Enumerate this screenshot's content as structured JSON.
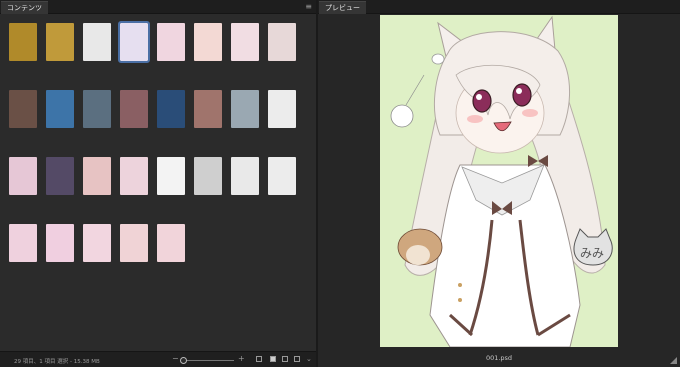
{
  "panels": {
    "contents_tab": "コンテンツ",
    "preview_tab": "プレビュー"
  },
  "thumbs": [
    {
      "color": "#b08a2a",
      "caption": "",
      "selected": false
    },
    {
      "color": "#c09a3a",
      "caption": "",
      "selected": false
    },
    {
      "color": "#e8e8e8",
      "caption": "",
      "selected": false
    },
    {
      "color": "#e6dff0",
      "caption": "",
      "selected": true
    },
    {
      "color": "#f0d6e0",
      "caption": "",
      "selected": false
    },
    {
      "color": "#f3d9d4",
      "caption": "",
      "selected": false
    },
    {
      "color": "#f1dde3",
      "caption": "",
      "selected": false
    },
    {
      "color": "#e7d8d8",
      "caption": "",
      "selected": false
    },
    {
      "color": "#6a5046",
      "caption": "",
      "selected": false
    },
    {
      "color": "#3d74a8",
      "caption": "",
      "selected": false
    },
    {
      "color": "#5b6f80",
      "caption": "",
      "selected": false
    },
    {
      "color": "#8a5f63",
      "caption": "",
      "selected": false
    },
    {
      "color": "#2a4d78",
      "caption": "",
      "selected": false
    },
    {
      "color": "#a0746c",
      "caption": "",
      "selected": false
    },
    {
      "color": "#9aa8b2",
      "caption": "",
      "selected": false
    },
    {
      "color": "#ececec",
      "caption": "",
      "selected": false
    },
    {
      "color": "#e6c7d6",
      "caption": "",
      "selected": false
    },
    {
      "color": "#544a66",
      "caption": "",
      "selected": false
    },
    {
      "color": "#e7c3c3",
      "caption": "",
      "selected": false
    },
    {
      "color": "#edd3dc",
      "caption": "",
      "selected": false
    },
    {
      "color": "#f3f3f3",
      "caption": "",
      "selected": false
    },
    {
      "color": "#cfcfcf",
      "caption": "",
      "selected": false
    },
    {
      "color": "#e9e9e9",
      "caption": "",
      "selected": false
    },
    {
      "color": "#ececec",
      "caption": "",
      "selected": false
    },
    {
      "color": "#efd1de",
      "caption": "",
      "selected": false
    },
    {
      "color": "#f0cfe0",
      "caption": "",
      "selected": false
    },
    {
      "color": "#f2d6e0",
      "caption": "",
      "selected": false
    },
    {
      "color": "#f0d3d6",
      "caption": "",
      "selected": false
    },
    {
      "color": "#f1d4da",
      "caption": "",
      "selected": false
    }
  ],
  "status": {
    "text": "29 項目、1 項目 選択 - 15.38 MB",
    "zoom_minus": "−",
    "zoom_plus": "+"
  },
  "preview": {
    "filename": "001.psd",
    "tag_text": "みみ"
  },
  "colors": {
    "accent": "#4a6fa5",
    "preview_bg": "#dff0c6"
  }
}
